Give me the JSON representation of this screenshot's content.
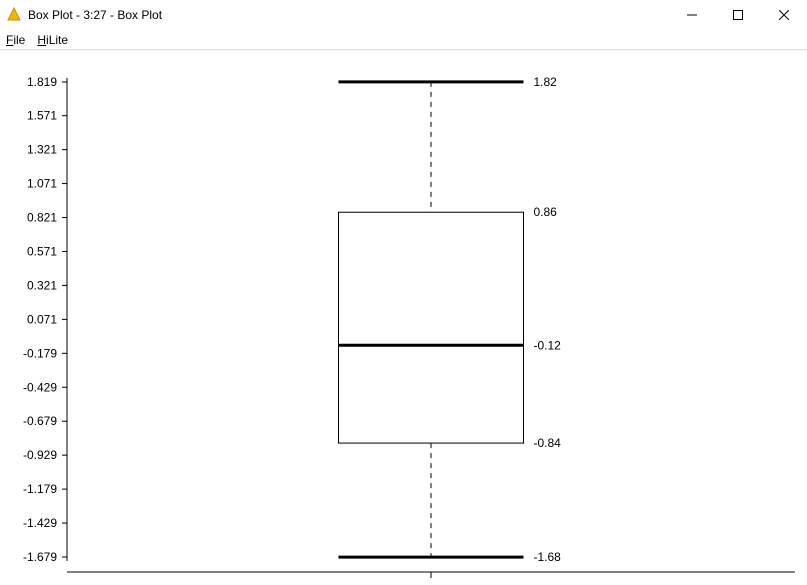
{
  "window": {
    "title": "Box Plot - 3:27 - Box Plot"
  },
  "menu": {
    "file": "File",
    "hilite": "HiLite"
  },
  "chart_data": {
    "type": "boxplot",
    "ylim": [
      -1.679,
      1.819
    ],
    "ticks": [
      1.819,
      1.571,
      1.321,
      1.071,
      0.821,
      0.571,
      0.321,
      0.071,
      -0.179,
      -0.429,
      -0.679,
      -0.929,
      -1.179,
      -1.429,
      -1.679
    ],
    "tick_labels": [
      "1.819",
      "1.571",
      "1.321",
      "1.071",
      "0.821",
      "0.571",
      "0.321",
      "0.071",
      "-0.179",
      "-0.429",
      "-0.679",
      "-0.929",
      "-1.179",
      "-1.429",
      "-1.679"
    ],
    "box": {
      "max_whisker": 1.82,
      "q3": 0.86,
      "median": -0.12,
      "q1": -0.84,
      "min_whisker": -1.68
    },
    "value_labels": {
      "max": "1.82",
      "q3": "0.86",
      "median": "-0.12",
      "q1": "-0.84",
      "min": "-1.68"
    }
  }
}
